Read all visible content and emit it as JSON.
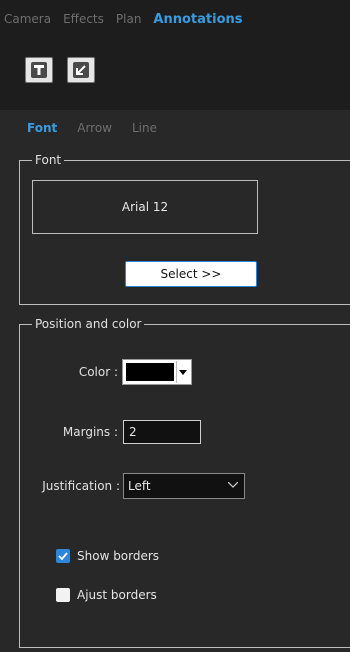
{
  "main_tabs": [
    {
      "label": "Camera",
      "active": false
    },
    {
      "label": "Effects",
      "active": false
    },
    {
      "label": "Plan",
      "active": false
    },
    {
      "label": "Annotations",
      "active": true
    }
  ],
  "tools": [
    {
      "icon": "text-tool-icon"
    },
    {
      "icon": "arrow-tool-icon"
    }
  ],
  "sub_tabs": [
    {
      "label": "Font",
      "active": true
    },
    {
      "label": "Arrow",
      "active": false
    },
    {
      "label": "Line",
      "active": false
    }
  ],
  "font_group": {
    "legend": "Font",
    "font_display": "Arial 12",
    "select_label": "Select >>"
  },
  "position_group": {
    "legend": "Position and color",
    "color_label": "Color :",
    "color_value": "#000000",
    "margins_label": "Margins :",
    "margins_value": "2",
    "justification_label": "Justification :",
    "justification_value": "Left",
    "show_borders": {
      "label": "Show borders",
      "checked": true
    },
    "adjust_borders": {
      "label": "Ajust borders",
      "checked": false
    }
  },
  "colors": {
    "accent": "#3a9be0",
    "background": "#1d1d1d",
    "panel": "#282828"
  }
}
